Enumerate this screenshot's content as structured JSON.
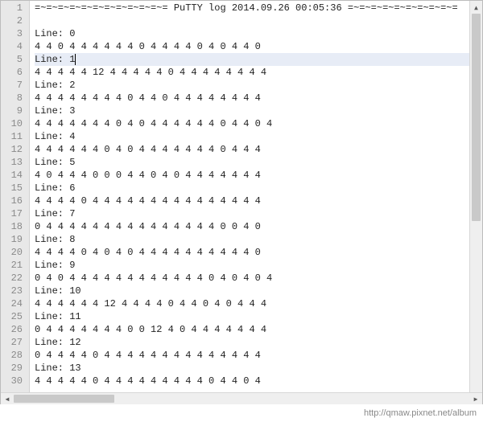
{
  "editor": {
    "selected_line_index": 4,
    "caret_line_index": 4,
    "caret_after_text": true,
    "lines": [
      {
        "n": 1,
        "t": "=~=~=~=~=~=~=~=~=~=~=~= PuTTY log 2014.09.26 00:05:36 =~=~=~=~=~=~=~=~=~="
      },
      {
        "n": 2,
        "t": ""
      },
      {
        "n": 3,
        "t": "Line: 0"
      },
      {
        "n": 4,
        "t": "4 4 0 4 4 4 4 4 4 0 4 4 4 4 0 4 0 4 4 0 "
      },
      {
        "n": 5,
        "t": "Line: 1"
      },
      {
        "n": 6,
        "t": "4 4 4 4 4 12 4 4 4 4 4 0 4 4 4 4 4 4 4 4 "
      },
      {
        "n": 7,
        "t": "Line: 2"
      },
      {
        "n": 8,
        "t": "4 4 4 4 4 4 4 4 0 4 4 0 4 4 4 4 4 4 4 4 "
      },
      {
        "n": 9,
        "t": "Line: 3"
      },
      {
        "n": 10,
        "t": "4 4 4 4 4 4 4 0 4 0 4 4 4 4 4 4 0 4 4 0 4 "
      },
      {
        "n": 11,
        "t": "Line: 4"
      },
      {
        "n": 12,
        "t": "4 4 4 4 4 4 0 4 0 4 4 4 4 4 4 4 0 4 4 4 "
      },
      {
        "n": 13,
        "t": "Line: 5"
      },
      {
        "n": 14,
        "t": "4 0 4 4 4 0 0 0 4 4 0 4 0 4 4 4 4 4 4 4 "
      },
      {
        "n": 15,
        "t": "Line: 6"
      },
      {
        "n": 16,
        "t": "4 4 4 4 0 4 4 4 4 4 4 4 4 4 4 4 4 4 4 4 "
      },
      {
        "n": 17,
        "t": "Line: 7"
      },
      {
        "n": 18,
        "t": "0 4 4 4 4 4 4 4 4 4 4 4 4 4 4 4 0 0 4 0 "
      },
      {
        "n": 19,
        "t": "Line: 8"
      },
      {
        "n": 20,
        "t": "4 4 4 4 0 4 0 4 0 4 4 4 4 4 4 4 4 4 4 0 "
      },
      {
        "n": 21,
        "t": "Line: 9"
      },
      {
        "n": 22,
        "t": "0 4 0 4 4 4 4 4 4 4 4 4 4 4 4 0 4 0 4 0 4 "
      },
      {
        "n": 23,
        "t": "Line: 10"
      },
      {
        "n": 24,
        "t": "4 4 4 4 4 4 12 4 4 4 4 0 4 4 0 4 0 4 4 4 "
      },
      {
        "n": 25,
        "t": "Line: 11"
      },
      {
        "n": 26,
        "t": "0 4 4 4 4 4 4 4 0 0 12 4 0 4 4 4 4 4 4 4 "
      },
      {
        "n": 27,
        "t": "Line: 12"
      },
      {
        "n": 28,
        "t": "0 4 4 4 4 0 4 4 4 4 4 4 4 4 4 4 4 4 4 4 "
      },
      {
        "n": 29,
        "t": "Line: 13"
      },
      {
        "n": 30,
        "t": "4 4 4 4 4 0 4 4 4 4 4 4 4 4 4 0 4 4 0 4 "
      }
    ]
  },
  "scroll": {
    "up_glyph": "▴",
    "down_glyph": "▾",
    "left_glyph": "◂",
    "right_glyph": "▸"
  },
  "footer": {
    "watermark": "http://qmaw.pixnet.net/album"
  }
}
